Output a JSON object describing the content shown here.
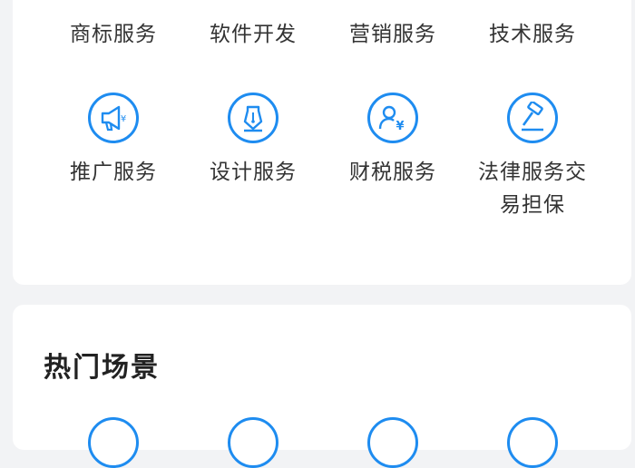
{
  "services": {
    "row1": [
      "商标服务",
      "软件开发",
      "营销服务",
      "技术服务"
    ],
    "row2": [
      {
        "label": "推广服务",
        "icon": "megaphone-icon"
      },
      {
        "label": "设计服务",
        "icon": "pen-nib-icon"
      },
      {
        "label": "财税服务",
        "icon": "finance-person-icon"
      },
      {
        "label": "法律服务交易担保",
        "icon": "gavel-icon"
      }
    ]
  },
  "hot_scenes": {
    "title": "热门场景"
  },
  "colors": {
    "accent": "#1e8cf0",
    "background": "#f2f3f5",
    "card": "#ffffff"
  }
}
